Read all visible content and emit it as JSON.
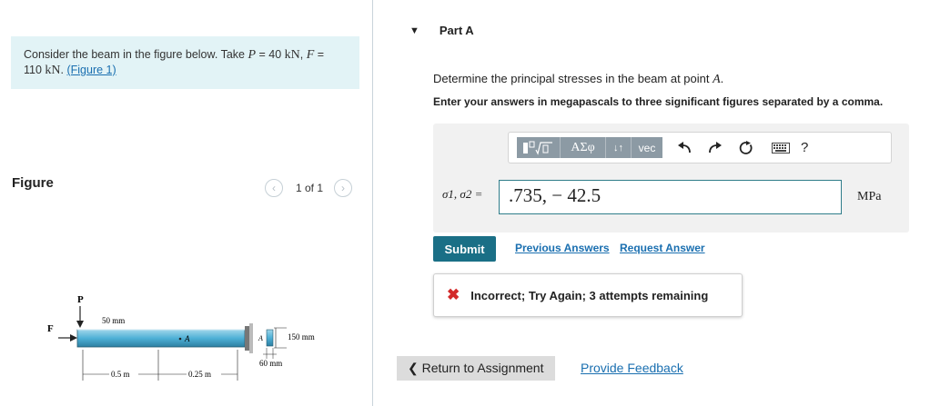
{
  "problem": {
    "text_before": "Consider the beam in the figure below. Take ",
    "p_var": "P",
    "p_eq": " = 40 ",
    "p_unit": "kN",
    "sep": ", ",
    "f_var": "F",
    "f_eq": " = ",
    "f_line2": "110 ",
    "f_unit": "kN",
    "period": ". ",
    "figure_link": "(Figure 1)"
  },
  "figure": {
    "title": "Figure",
    "pager_text": "1 of 1",
    "prev_icon": "chevron-left-icon",
    "next_icon": "chevron-right-icon",
    "labels": {
      "p": "P",
      "f": "F",
      "a": "A",
      "a_section": "A",
      "dim_50": "50 mm",
      "dim_150": "150 mm",
      "dim_60": "60 mm",
      "dim_05": "0.5 m",
      "dim_025": "0.25 m"
    },
    "colors": {
      "beam": "#4eb0d6",
      "beam_dark": "#2c6f8a"
    }
  },
  "part": {
    "caret_icon": "triangle-down-icon",
    "title": "Part A",
    "question_before": "Determine the principal stresses in the beam at point ",
    "question_var": "A",
    "question_after": ".",
    "instruction": "Enter your answers in megapascals to three significant figures separated by a comma."
  },
  "toolbar": {
    "templates_icon": "templates-icon",
    "greek_label": "ΑΣφ",
    "arrows_label": "↓↑",
    "vec_label": "vec",
    "undo_icon": "undo-icon",
    "redo_icon": "redo-icon",
    "reset_icon": "reset-icon",
    "keyboard_icon": "keyboard-icon",
    "help_label": "?"
  },
  "answer": {
    "label": "σ1, σ2 =",
    "value": ".735, − 42.5",
    "unit": "MPa"
  },
  "actions": {
    "submit": "Submit",
    "previous_answers": "Previous Answers",
    "request_answer": "Request Answer"
  },
  "feedback": {
    "icon": "x-icon",
    "message": "Incorrect; Try Again; 3 attempts remaining"
  },
  "footer": {
    "return_label": "Return to Assignment",
    "return_icon": "chevron-left-icon",
    "feedback_link": "Provide Feedback"
  },
  "colors": {
    "accent": "#1a6f86",
    "link": "#1a6fb0",
    "problem_bg": "#e2f3f6",
    "error": "#d32a2a"
  }
}
